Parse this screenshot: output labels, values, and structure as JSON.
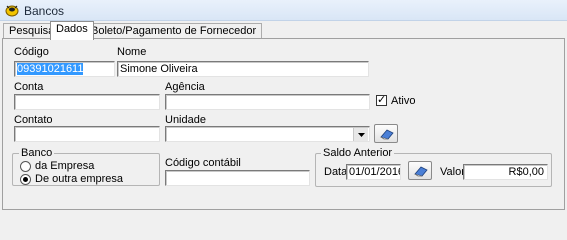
{
  "window": {
    "title": "Bancos"
  },
  "tabs": [
    {
      "label": "Pesquisa"
    },
    {
      "label": "Dados"
    },
    {
      "label": "Boleto/Pagamento de Fornecedor"
    }
  ],
  "form": {
    "codigo": {
      "label": "Código",
      "value": "09391021611"
    },
    "nome": {
      "label": "Nome",
      "value": "Simone Oliveira"
    },
    "conta": {
      "label": "Conta",
      "value": ""
    },
    "agencia": {
      "label": "Agência",
      "value": ""
    },
    "ativo": {
      "label": "Ativo",
      "checked": true
    },
    "contato": {
      "label": "Contato",
      "value": ""
    },
    "unidade": {
      "label": "Unidade",
      "value": ""
    },
    "banco": {
      "title": "Banco",
      "options": [
        "da Empresa",
        "De outra empresa"
      ],
      "selected": "De outra empresa"
    },
    "codigo_contabil": {
      "label": "Código contábil",
      "value": ""
    },
    "saldo_anterior": {
      "title": "Saldo Anterior",
      "data_label": "Data",
      "data_value": "01/01/2016",
      "valor_label": "Valor",
      "valor_value": "R$0,00"
    }
  },
  "icons": {
    "app": "bank-app-icon",
    "eraser": "eraser-icon",
    "dropdown": "chevron-down-icon"
  }
}
